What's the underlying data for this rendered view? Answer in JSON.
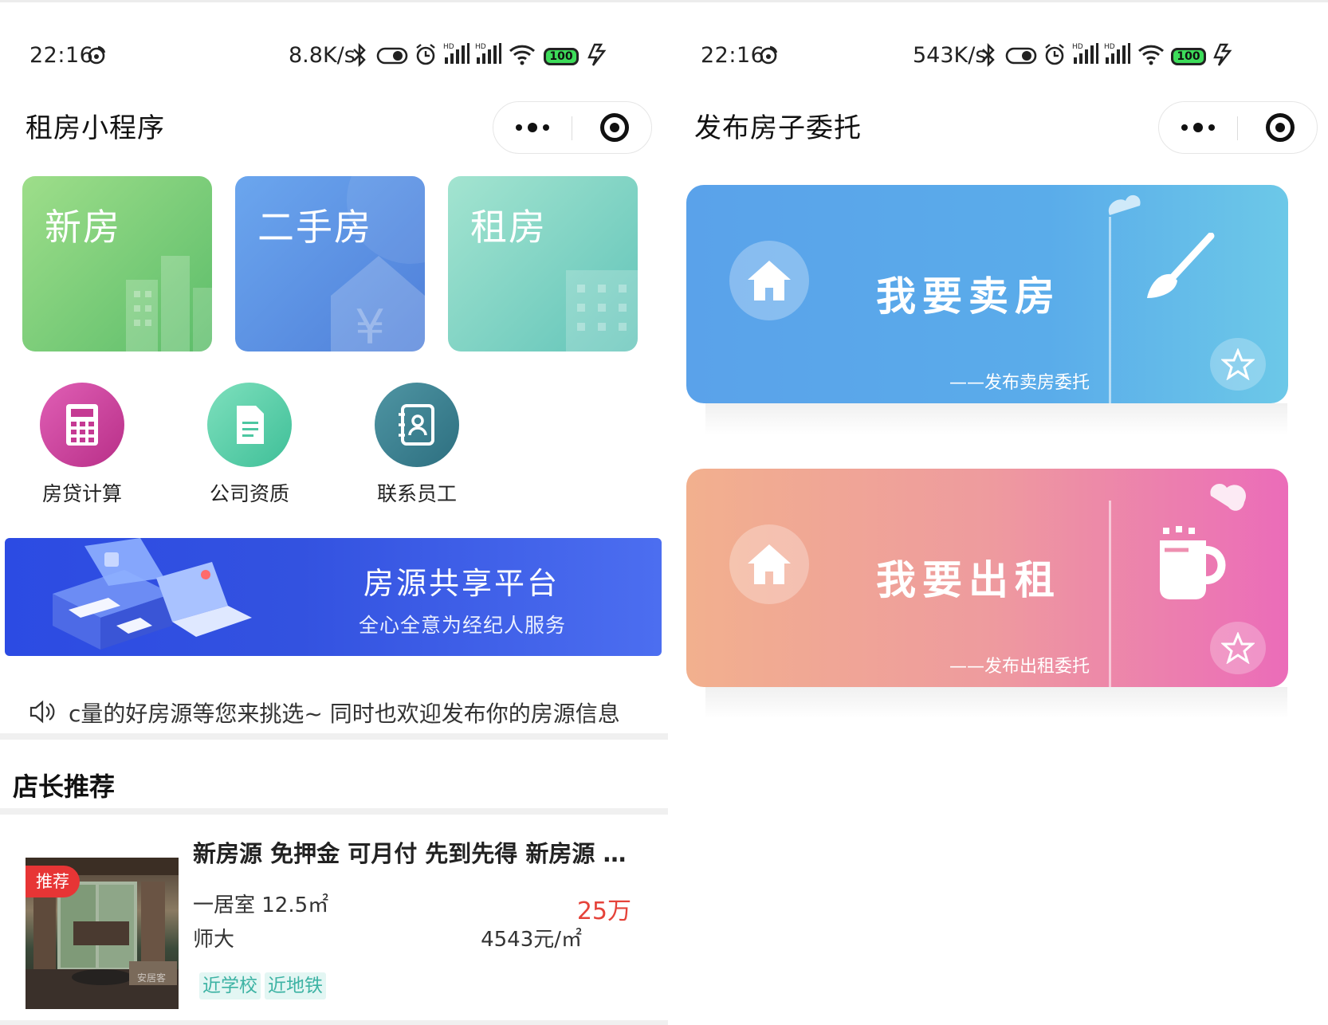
{
  "status_left": {
    "time": "22:16",
    "speed": "8.8K/s",
    "battery": "100"
  },
  "status_right": {
    "time": "22:16",
    "speed": "543K/s",
    "battery": "100"
  },
  "left": {
    "title": "租房小程序",
    "tiles": [
      {
        "label": "新房"
      },
      {
        "label": "二手房"
      },
      {
        "label": "租房"
      }
    ],
    "quick": [
      {
        "label": "房贷计算"
      },
      {
        "label": "公司资质"
      },
      {
        "label": "联系员工"
      }
    ],
    "banner": {
      "title": "房源共享平台",
      "subtitle": "全心全意为经纪人服务"
    },
    "notice": "c量的好房源等您来挑选~ 同时也欢迎发布你的房源信息",
    "section_title": "店长推荐",
    "listing": {
      "badge": "推荐",
      "title": "新房源 免押金 可月付 先到先得 新房源 …",
      "room": "一居室 12.5㎡",
      "price": "25万",
      "area": "师大",
      "unit_price": "4543元/㎡",
      "tags": [
        "近学校",
        "近地铁"
      ]
    }
  },
  "right": {
    "title": "发布房子委托",
    "cards": [
      {
        "title": "我要卖房",
        "subtitle": "——发布卖房委托"
      },
      {
        "title": "我要出租",
        "subtitle": "——发布出租委托"
      }
    ]
  },
  "colors": {
    "sell_card": "#5aa2ea",
    "rent_card": "#eb6cb9",
    "banner": "#2c4be3",
    "price": "#e5433a",
    "tag": "#3db3a4",
    "badge": "#e73535"
  },
  "icons": [
    "weibo-icon",
    "bluetooth-icon",
    "toggle-icon",
    "alarm-icon",
    "signal-icon",
    "wifi-icon",
    "battery-icon",
    "charging-icon",
    "more-dots-icon",
    "target-icon",
    "calculator-icon",
    "document-icon",
    "contact-book-icon",
    "speaker-icon",
    "house-icon",
    "brush-icon",
    "cup-icon",
    "star-icon",
    "cloud-icon"
  ]
}
